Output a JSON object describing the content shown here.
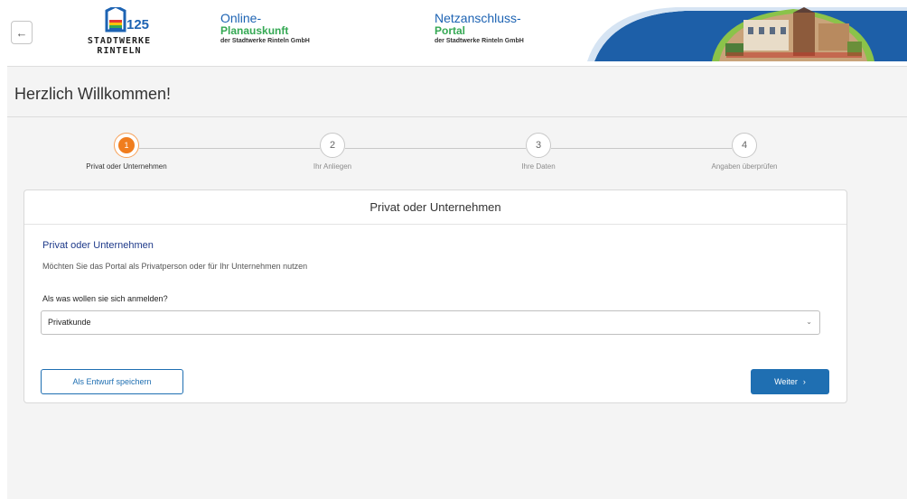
{
  "header": {
    "back_icon": "arrow-left-icon",
    "logo": {
      "badge": "125",
      "line1": "STADTWERKE",
      "line2": "RINTELN"
    },
    "left_block": {
      "title": "Online-",
      "subtitle": "Planauskunft",
      "company": "der Stadtwerke Rinteln GmbH"
    },
    "right_block": {
      "title": "Netzanschluss-",
      "subtitle": "Portal",
      "company": "der Stadtwerke Rinteln GmbH"
    }
  },
  "page": {
    "title": "Herzlich Willkommen!"
  },
  "stepper": {
    "steps": [
      {
        "number": "1",
        "label": "Privat oder Unternehmen",
        "active": true
      },
      {
        "number": "2",
        "label": "Ihr Anliegen",
        "active": false
      },
      {
        "number": "3",
        "label": "Ihre Daten",
        "active": false
      },
      {
        "number": "4",
        "label": "Angaben überprüfen",
        "active": false
      }
    ]
  },
  "card": {
    "header": "Privat oder Unternehmen",
    "section_title": "Privat oder Unternehmen",
    "section_description": "Möchten Sie das Portal als Privatperson oder für Ihr Unternehmen nutzen",
    "field_label": "Als was wollen sie sich anmelden?",
    "select_value": "Privatkunde",
    "save_draft_label": "Als Entwurf speichern",
    "next_label": "Weiter",
    "next_icon": "chevron-right-icon"
  },
  "colors": {
    "primary": "#1f6fb2",
    "active_step": "#f07d1e",
    "green": "#34a853"
  }
}
